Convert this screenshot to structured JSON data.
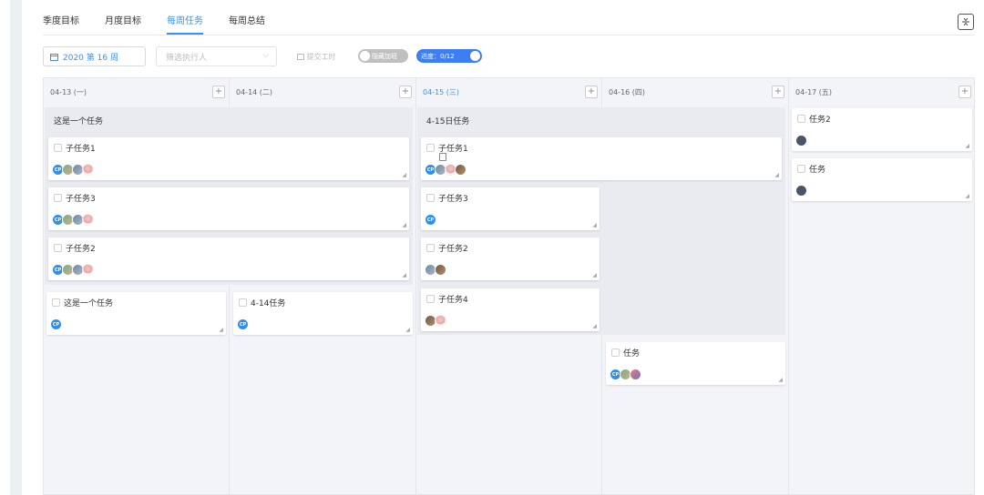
{
  "tabs": [
    {
      "label": "季度目标"
    },
    {
      "label": "月度目标"
    },
    {
      "label": "每周任务"
    },
    {
      "label": "每周总结"
    }
  ],
  "active_tab": "每周任务",
  "toolbar": {
    "week_label": "2020 第 16 周",
    "executor_placeholder": "筛选执行人",
    "submit_label": "提交工时",
    "hide_toggle_label": "隐藏加班",
    "progress_label": "进度：0/12"
  },
  "accent_color": "#3d8ef0",
  "columns": [
    {
      "date": "04-13",
      "weekday": "(一)"
    },
    {
      "date": "04-14",
      "weekday": "(二)"
    },
    {
      "date": "04-15",
      "weekday": "(三)"
    },
    {
      "date": "04-16",
      "weekday": "(四)"
    },
    {
      "date": "04-17",
      "weekday": "(五)"
    }
  ],
  "groups": [
    {
      "title": "这是一个任务"
    },
    {
      "title": "4-15日任务"
    }
  ],
  "cards": [
    {
      "title": "子任务1",
      "avatars": [
        "CP"
      ]
    },
    {
      "title": "子任务3",
      "avatars": [
        "CP"
      ]
    },
    {
      "title": "子任务2",
      "avatars": [
        "CP"
      ]
    },
    {
      "title": "这是一个任务",
      "avatars": [
        "CP"
      ]
    },
    {
      "title": "4-14任务",
      "avatars": [
        "CP"
      ]
    },
    {
      "title": "子任务1",
      "avatars": [
        "CP"
      ]
    },
    {
      "title": "子任务3",
      "avatars": [
        "CP"
      ]
    },
    {
      "title": "子任务2",
      "avatars": []
    },
    {
      "title": "子任务4",
      "avatars": []
    },
    {
      "title": "任务",
      "avatars": [
        "CP"
      ]
    },
    {
      "title": "任务2",
      "avatars": []
    },
    {
      "title": "任务",
      "avatars": []
    }
  ],
  "add_symbol": "+",
  "collapse_symbol": "⇕"
}
